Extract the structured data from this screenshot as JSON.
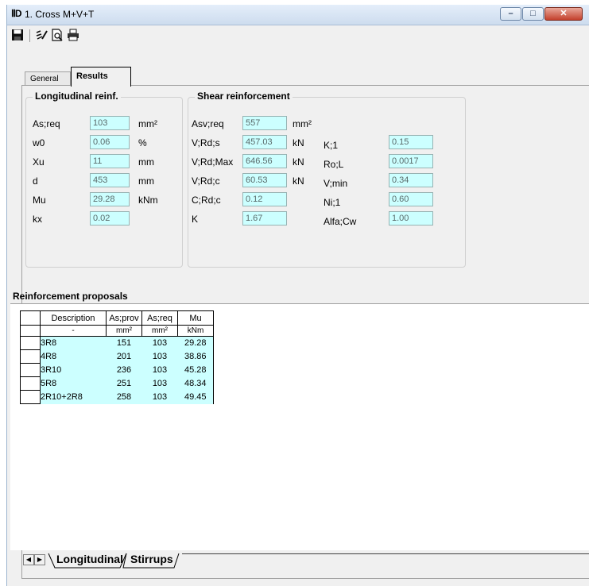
{
  "window": {
    "icon": "app-logo-icon",
    "title": "1. Cross M+V+T",
    "controls": {
      "minimize": "–",
      "maximize": "□",
      "close": "✕"
    }
  },
  "toolbar": {
    "items": [
      "save-icon",
      "edit-icon",
      "print-preview-icon",
      "print-icon"
    ]
  },
  "tabs": {
    "general": "General",
    "results": "Results",
    "active": "Results"
  },
  "longitudinal": {
    "title": "Longitudinal reinf.",
    "rows": [
      {
        "label": "As;req",
        "value": "103",
        "unit": "mm²"
      },
      {
        "label": "w0",
        "value": "0.06",
        "unit": "%"
      },
      {
        "label": "Xu",
        "value": "11",
        "unit": "mm"
      },
      {
        "label": "d",
        "value": "453",
        "unit": "mm"
      },
      {
        "label": "Mu",
        "value": "29.28",
        "unit": "kNm"
      },
      {
        "label": "kx",
        "value": "0.02",
        "unit": ""
      }
    ]
  },
  "shear": {
    "title": "Shear reinforcement",
    "left_rows": [
      {
        "label": "Asv;req",
        "value": "557",
        "unit": "mm²"
      },
      {
        "label": "V;Rd;s",
        "value": "457.03",
        "unit": "kN"
      },
      {
        "label": "V;Rd;Max",
        "value": "646.56",
        "unit": "kN"
      },
      {
        "label": "V;Rd;c",
        "value": "60.53",
        "unit": "kN"
      },
      {
        "label": "C;Rd;c",
        "value": "0.12",
        "unit": ""
      },
      {
        "label": "K",
        "value": "1.67",
        "unit": ""
      }
    ],
    "right_rows": [
      {
        "label": "K;1",
        "value": "0.15"
      },
      {
        "label": "Ro;L",
        "value": "0.0017"
      },
      {
        "label": "V;min",
        "value": "0.34"
      },
      {
        "label": "Ni;1",
        "value": "0.60"
      },
      {
        "label": "Alfa;Cw",
        "value": "1.00"
      }
    ]
  },
  "proposals": {
    "title": "Reinforcement proposals",
    "columns": [
      "Description",
      "As;prov",
      "As;req",
      "Mu"
    ],
    "units": [
      "-",
      "mm²",
      "mm²",
      "kNm"
    ],
    "rows": [
      [
        "3R8",
        "151",
        "103",
        "29.28"
      ],
      [
        "4R8",
        "201",
        "103",
        "38.86"
      ],
      [
        "3R10",
        "236",
        "103",
        "45.28"
      ],
      [
        "5R8",
        "251",
        "103",
        "48.34"
      ],
      [
        "2R10+2R8",
        "258",
        "103",
        "49.45"
      ]
    ]
  },
  "sheet_tabs": {
    "prev": "◀",
    "next": "▶",
    "tab1": "Longitudinal",
    "tab2": "Stirrups"
  }
}
